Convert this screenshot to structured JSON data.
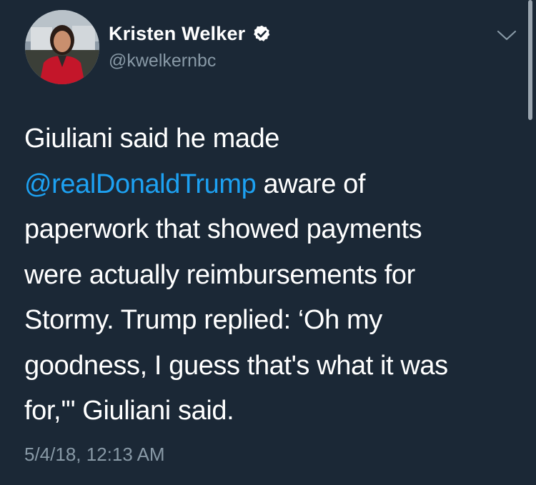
{
  "user": {
    "display_name": "Kristen Welker",
    "handle": "@kwelkernbc",
    "verified_icon": "verified-badge-icon",
    "avatar_icon": "avatar"
  },
  "tweet": {
    "lines": [
      {
        "text": "Giuliani said he made"
      },
      {
        "mention": "@realDonaldTrump",
        "text": " aware of"
      },
      {
        "text": "paperwork that showed payments"
      },
      {
        "text": "were actually reimbursements for"
      },
      {
        "text": "Stormy. Trump replied: ‘Oh my"
      },
      {
        "text": "goodness, I guess that's what it was"
      },
      {
        "text": "for,'\" Giuliani said."
      }
    ],
    "timestamp": "5/4/18, 12:13 AM"
  },
  "colors": {
    "background": "#1b2836",
    "text": "#ffffff",
    "secondary": "#8899a6",
    "link": "#1da1f2"
  },
  "menu_icon": "chevron-down-icon"
}
